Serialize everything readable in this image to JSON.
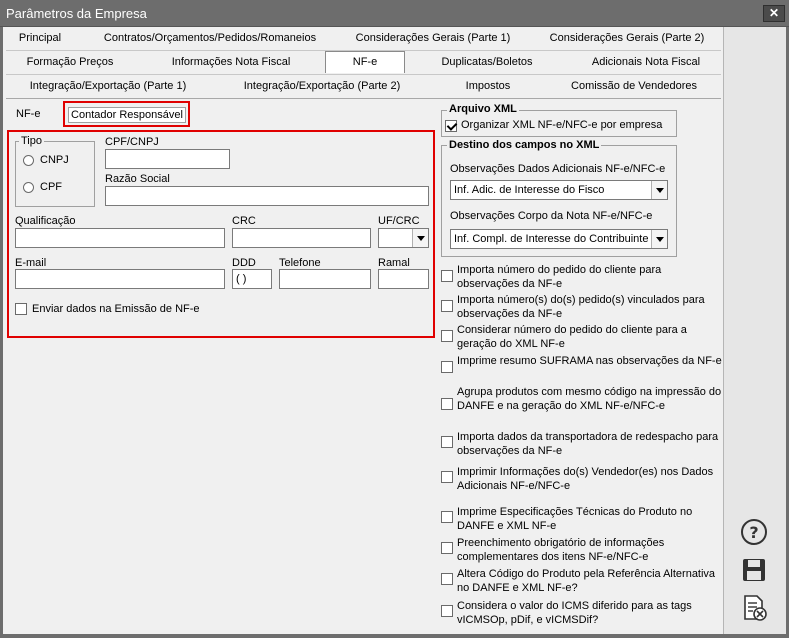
{
  "window": {
    "title": "Parâmetros da Empresa",
    "close_glyph": "✕"
  },
  "tabs": {
    "row1": [
      "Principal",
      "Contratos/Orçamentos/Pedidos/Romaneios",
      "Considerações Gerais (Parte 1)",
      "Considerações Gerais (Parte 2)"
    ],
    "row2": [
      "Formação Preços",
      "Informações Nota Fiscal",
      "NF-e",
      "Duplicatas/Boletos",
      "Adicionais Nota Fiscal"
    ],
    "row3": [
      "Integração/Exportação (Parte 1)",
      "Integração/Exportação (Parte 2)",
      "Impostos",
      "Comissão de Vendedores"
    ],
    "selected": "NF-e"
  },
  "subtabs": {
    "nfe": "NF-e",
    "contador": "Contador Responsável"
  },
  "contador": {
    "tipo_label": "Tipo",
    "cnpj_label": "CNPJ",
    "cpf_label": "CPF",
    "cpf_cnpj_label": "CPF/CNPJ",
    "razao_social_label": "Razão Social",
    "qualificacao_label": "Qualificação",
    "crc_label": "CRC",
    "uf_crc_label": "UF/CRC",
    "email_label": "E-mail",
    "ddd_label": "DDD",
    "ddd_value": "( )",
    "telefone_label": "Telefone",
    "ramal_label": "Ramal",
    "enviar_label": "Enviar dados na Emissão de NF-e"
  },
  "arquivo_xml": {
    "legend": "Arquivo XML",
    "organizar_label": "Organizar XML NF-e/NFC-e por empresa",
    "organizar_checked": true
  },
  "destino": {
    "legend": "Destino dos campos no XML",
    "obs_dados_label": "Observações Dados Adicionais NF-e/NFC-e",
    "obs_dados_value": "Inf. Adic. de Interesse do Fisco",
    "obs_corpo_label": "Observações Corpo da Nota NF-e/NFC-e",
    "obs_corpo_value": "Inf. Compl. de Interesse do Contribuinte"
  },
  "options": [
    "Importa número do pedido do cliente para observações da NF-e",
    "Importa número(s) do(s) pedido(s) vinculados para observações da NF-e",
    "Considerar número do pedido do cliente para a geração do XML NF-e",
    "Imprime resumo SUFRAMA nas observações da NF-e",
    "Agrupa produtos com  mesmo código na impressão do DANFE e na geração do XML NF-e/NFC-e",
    "Importa dados da transportadora de redespacho para observações da NF-e",
    "Imprimir Informações do(s) Vendedor(es) nos Dados Adicionais NF-e/NFC-e",
    "Imprime Especificações Técnicas do Produto no DANFE e XML NF-e",
    "Preenchimento obrigatório de informações complementares dos itens NF-e/NFC-e",
    "Altera Código do Produto pela Referência Alternativa no DANFE e XML NF-e?",
    "Considera o valor do ICMS diferido para as tags vICMSOp, pDif, e vICMSDif?"
  ],
  "icons": [
    "help-icon",
    "save-icon",
    "cancel-document-icon"
  ]
}
